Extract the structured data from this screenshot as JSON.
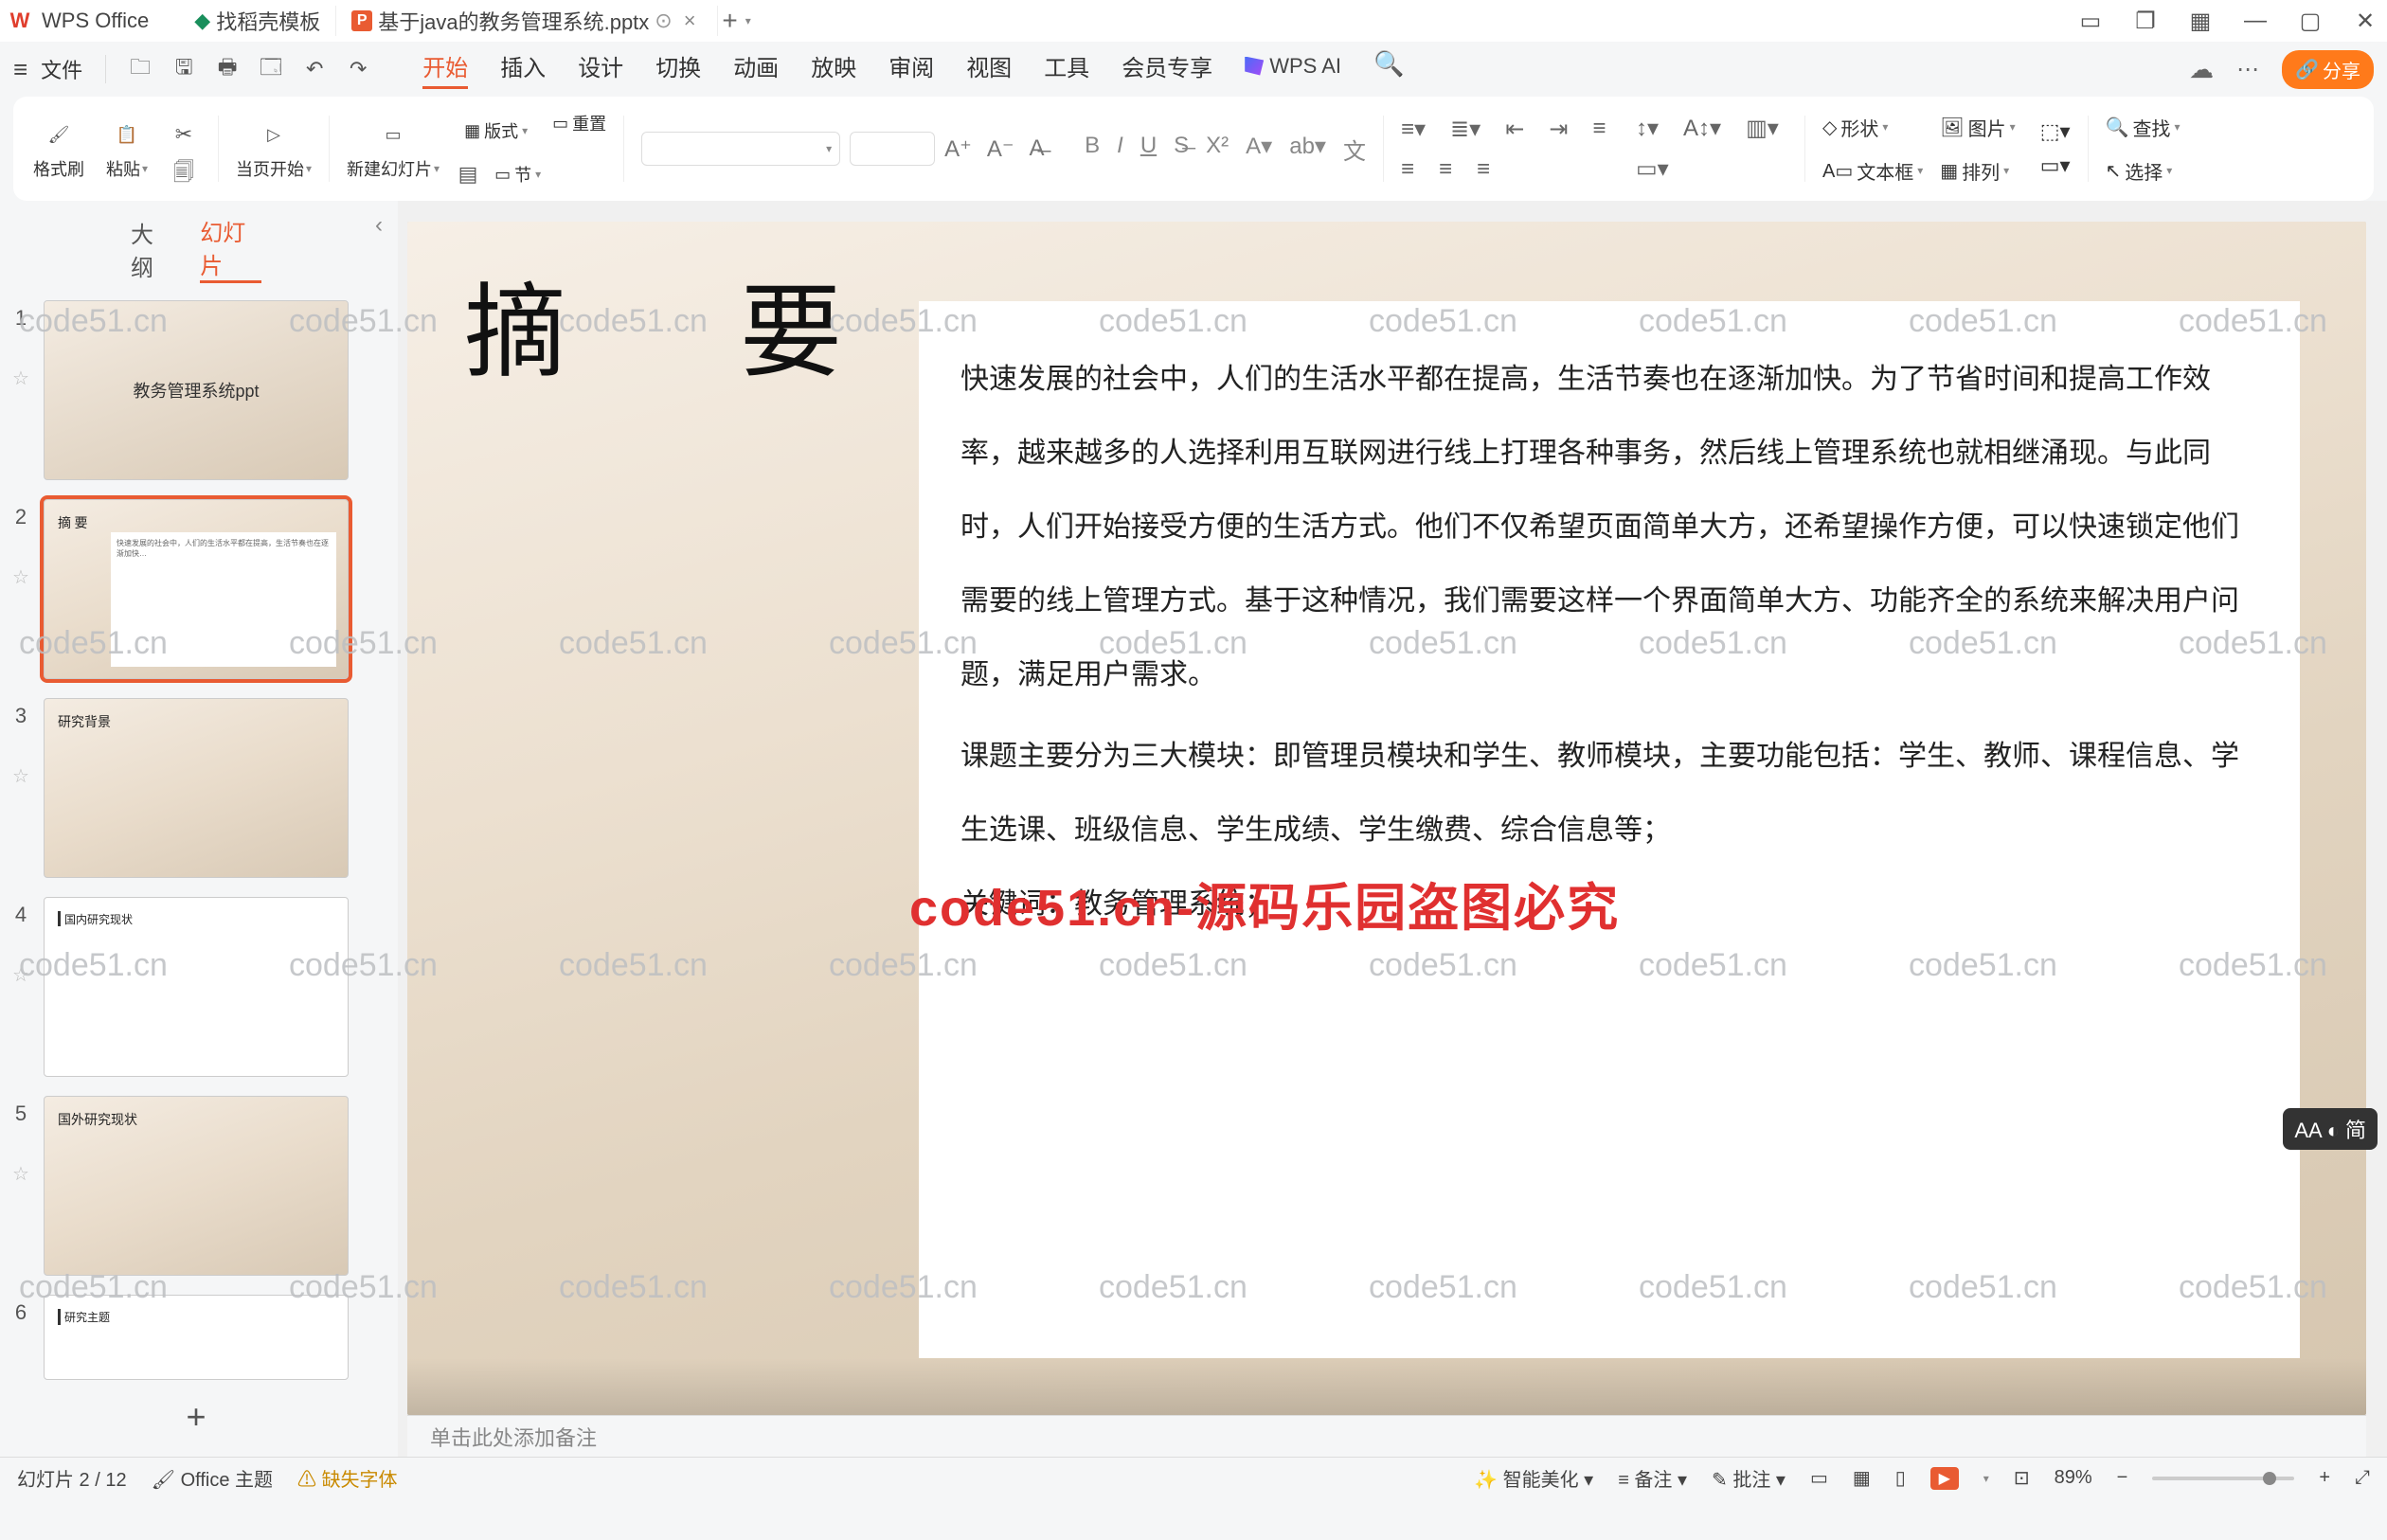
{
  "app": {
    "title": "WPS Office"
  },
  "tabs": {
    "template": "找稻壳模板",
    "active": "基于java的教务管理系统.pptx",
    "close": "×",
    "new": "+"
  },
  "winctrl": {
    "layout": "▢",
    "cube": "⬚",
    "avatar": "▦",
    "min": "—",
    "max": "▢",
    "close": "✕"
  },
  "file": {
    "label": "文件"
  },
  "menu": {
    "start": "开始",
    "insert": "插入",
    "design": "设计",
    "transition": "切换",
    "animation": "动画",
    "show": "放映",
    "review": "审阅",
    "view": "视图",
    "tools": "工具",
    "member": "会员专享",
    "ai": "WPS AI"
  },
  "share": {
    "label": "分享"
  },
  "ribbon": {
    "format_brush": "格式刷",
    "paste": "粘贴",
    "from_current": "当页开始",
    "new_slide": "新建幻灯片",
    "layout": "版式",
    "reset": "重置",
    "section": "节",
    "wen": "文",
    "shape": "形状",
    "picture": "图片",
    "textbox": "文本框",
    "arrange": "排列",
    "find": "查找",
    "select": "选择"
  },
  "side": {
    "outline": "大纲",
    "slides": "幻灯片",
    "add": "+"
  },
  "thumbs": {
    "t1": "教务管理系统ppt",
    "t2": "摘  要",
    "t3": "研究背景",
    "t4": "国内研究现状",
    "t5": "国外研究现状",
    "t6": "研究主题"
  },
  "slide": {
    "title": "摘    要",
    "p1": "快速发展的社会中，人们的生活水平都在提高，生活节奏也在逐渐加快。为了节省时间和提高工作效率，越来越多的人选择利用互联网进行线上打理各种事务，然后线上管理系统也就相继涌现。与此同时，人们开始接受方便的生活方式。他们不仅希望页面简单大方，还希望操作方便，可以快速锁定他们需要的线上管理方式。基于这种情况，我们需要这样一个界面简单大方、功能齐全的系统来解决用户问题，满足用户需求。",
    "p2": "课题主要分为三大模块：即管理员模块和学生、教师模块，主要功能包括：学生、教师、课程信息、学生选课、班级信息、学生成绩、学生缴费、综合信息等；",
    "p3": "关键词：教务管理系统；",
    "overlay": "code51.cn-源码乐园盗图必究"
  },
  "watermark": "code51.cn",
  "notes": {
    "placeholder": "单击此处添加备注"
  },
  "status": {
    "slide": "幻灯片 2 / 12",
    "theme": "Office 主题",
    "missfont": "缺失字体",
    "beautify": "智能美化",
    "notes": "备注",
    "review": "批注",
    "zoom": "89%"
  },
  "aa_pill": {
    "text": "AA ◐ 简"
  }
}
